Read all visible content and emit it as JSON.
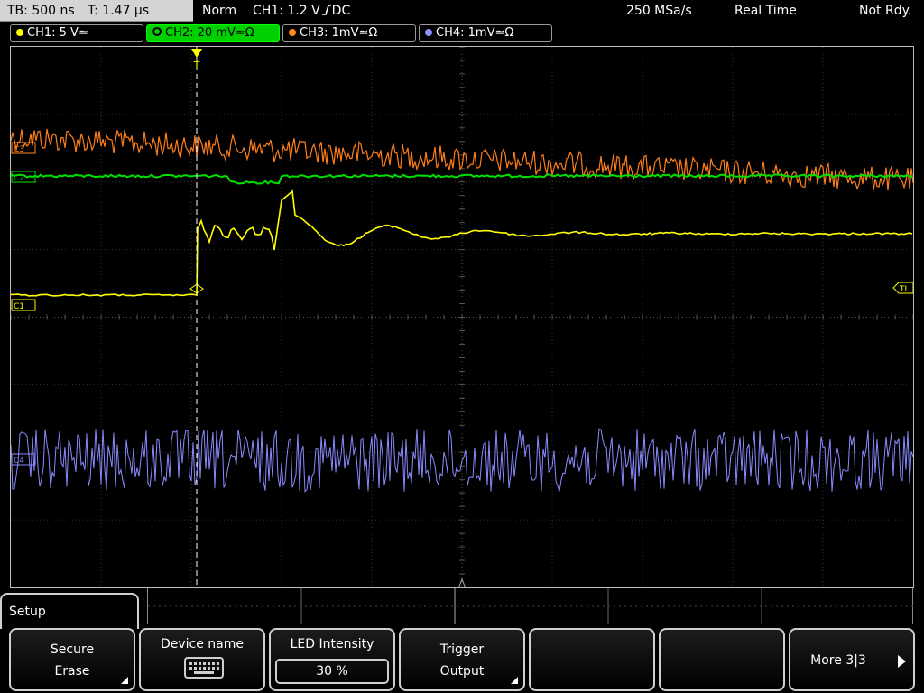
{
  "topbar": {
    "timebase": "TB: 500 ns",
    "trigger_time": "T: 1.47 µs",
    "mode": "Norm",
    "trigger_info": "CH1: 1.2 V",
    "trigger_coupling": "DC",
    "sample_rate": "250 MSa/s",
    "acq_mode": "Real Time",
    "status": "Not Rdy."
  },
  "channels": [
    {
      "label": "CH1: 5 V",
      "coupling": "≃",
      "color": "#ffff00"
    },
    {
      "label": "CH2: 20 mV",
      "coupling": "≃Ω",
      "color": "#00ff00"
    },
    {
      "label": "CH3: 1mV",
      "coupling": "≃Ω",
      "color": "#ff8c1a"
    },
    {
      "label": "CH4: 1mV",
      "coupling": "≃Ω",
      "color": "#8f8fff"
    }
  ],
  "markers": {
    "c1": "C1",
    "c2": "C2",
    "c3": "C3",
    "c4": "C4",
    "tl": "TL",
    "trigger_pos": "T"
  },
  "menu": {
    "title": "Setup",
    "softkeys": [
      {
        "line1": "Secure",
        "line2": "Erase"
      },
      {
        "line1": "Device name"
      },
      {
        "line1": "LED Intensity",
        "value": "30 %"
      },
      {
        "line1": "Trigger",
        "line2": "Output"
      },
      {
        "line1": ""
      },
      {
        "line1": ""
      },
      {
        "line1": "More 3|3"
      }
    ]
  }
}
